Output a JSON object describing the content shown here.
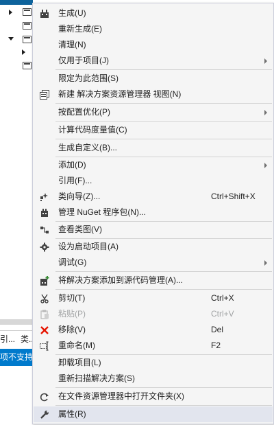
{
  "background": {
    "tabs": [
      "引...",
      "类..."
    ],
    "status_text": "项不支持搜"
  },
  "menu": {
    "items": [
      {
        "label": "生成(U)",
        "icon": "build-icon"
      },
      {
        "label": "重新生成(E)"
      },
      {
        "label": "清理(N)"
      },
      {
        "label": "仅用于项目(J)",
        "submenu": true
      },
      {
        "label": "限定为此范围(S)"
      },
      {
        "label": "新建 解决方案资源管理器 视图(N)",
        "icon": "new-view-icon"
      },
      {
        "label": "按配置优化(P)",
        "submenu": true
      },
      {
        "label": "计算代码度量值(C)"
      },
      {
        "label": "生成自定义(B)..."
      },
      {
        "label": "添加(D)",
        "submenu": true
      },
      {
        "label": "引用(F)..."
      },
      {
        "label": "类向导(Z)...",
        "shortcut": "Ctrl+Shift+X",
        "icon": "class-wizard-icon"
      },
      {
        "label": "管理 NuGet 程序包(N)...",
        "icon": "nuget-icon"
      },
      {
        "label": "查看类图(V)",
        "icon": "class-diagram-icon"
      },
      {
        "label": "设为启动项目(A)",
        "icon": "gear-icon"
      },
      {
        "label": "调试(G)",
        "submenu": true
      },
      {
        "label": "将解决方案添加到源代码管理(A)...",
        "icon": "source-control-icon"
      },
      {
        "label": "剪切(T)",
        "shortcut": "Ctrl+X",
        "icon": "cut-icon"
      },
      {
        "label": "粘贴(P)",
        "shortcut": "Ctrl+V",
        "icon": "paste-icon",
        "disabled": true
      },
      {
        "label": "移除(V)",
        "shortcut": "Del",
        "icon": "remove-icon"
      },
      {
        "label": "重命名(M)",
        "shortcut": "F2",
        "icon": "rename-icon"
      },
      {
        "label": "卸载项目(L)"
      },
      {
        "label": "重新扫描解决方案(S)"
      },
      {
        "label": "在文件资源管理器中打开文件夹(X)",
        "icon": "open-folder-icon"
      },
      {
        "label": "属性(R)",
        "icon": "wrench-icon",
        "hovered": true
      }
    ]
  },
  "colors": {
    "menu_bg": "#f5f5f5",
    "hover": "#e2e5ee",
    "remove_red": "#e51400",
    "status_blue": "#007acc"
  }
}
